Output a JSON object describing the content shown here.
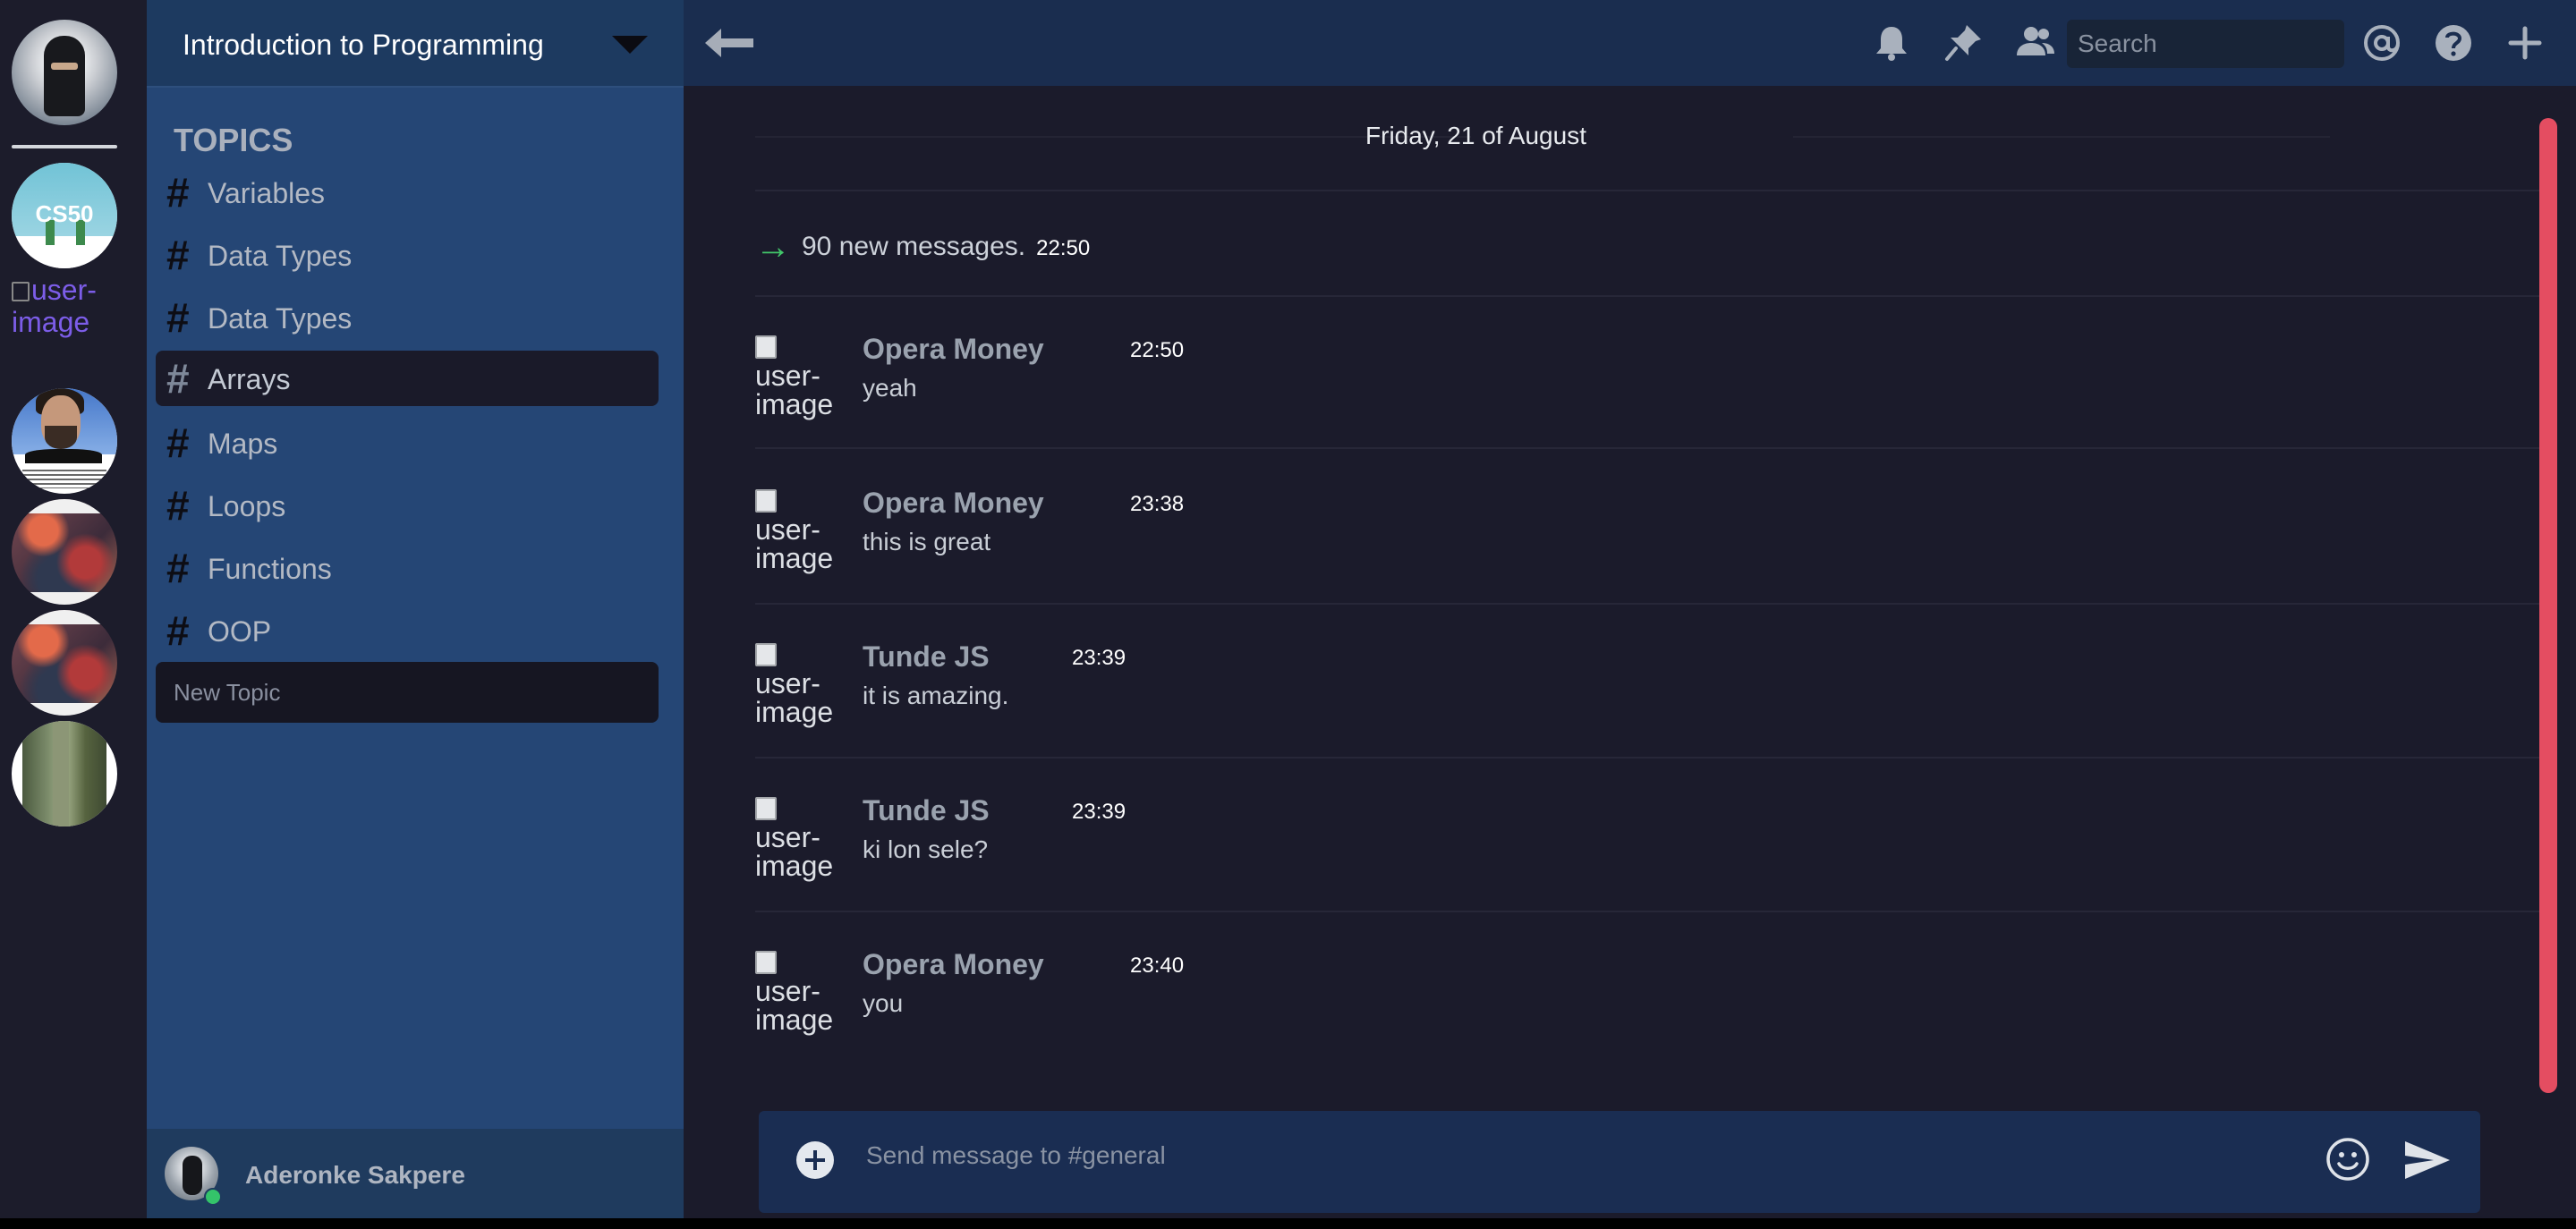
{
  "servers": {
    "broken_image_alt": "user-image"
  },
  "sidebar": {
    "course_title": "Introduction to Programming",
    "topics_heading": "TOPICS",
    "topics": [
      {
        "label": "Variables",
        "active": false
      },
      {
        "label": "Data Types",
        "active": false
      },
      {
        "label": "Data Types",
        "active": false
      },
      {
        "label": "Arrays",
        "active": true
      },
      {
        "label": "Maps",
        "active": false
      },
      {
        "label": "Loops",
        "active": false
      },
      {
        "label": "Functions",
        "active": false
      },
      {
        "label": "OOP",
        "active": false
      }
    ],
    "topic_hash": "#",
    "new_topic_placeholder": "New Topic",
    "user": {
      "name": "Aderonke Sakpere",
      "status_color": "#34c46a"
    }
  },
  "topbar": {
    "icons": [
      "back-arrow-icon",
      "bell-icon",
      "pin-icon",
      "members-icon",
      "at-icon",
      "help-icon",
      "plus-icon"
    ],
    "search_placeholder": "Search"
  },
  "chat": {
    "date_divider": "Friday, 21 of August",
    "new_messages": {
      "text": "90 new messages.",
      "time": "22:50"
    },
    "image_alt": "user-image",
    "messages": [
      {
        "author": "Opera Money",
        "time": "22:50",
        "body": "yeah"
      },
      {
        "author": "Opera Money",
        "time": "23:38",
        "body": "this is great"
      },
      {
        "author": "Tunde JS",
        "time": "23:39",
        "body": "it is amazing."
      },
      {
        "author": "Tunde JS",
        "time": "23:39",
        "body": "ki lon sele?"
      },
      {
        "author": "Opera Money",
        "time": "23:40",
        "body": "you"
      }
    ]
  },
  "composer": {
    "placeholder": "Send message to #general"
  },
  "colors": {
    "accent_scrollbar": "#e44d61",
    "sidebar_bg": "#254675",
    "main_bg": "#1b1b2b",
    "new_message_arrow": "#42c76a"
  }
}
